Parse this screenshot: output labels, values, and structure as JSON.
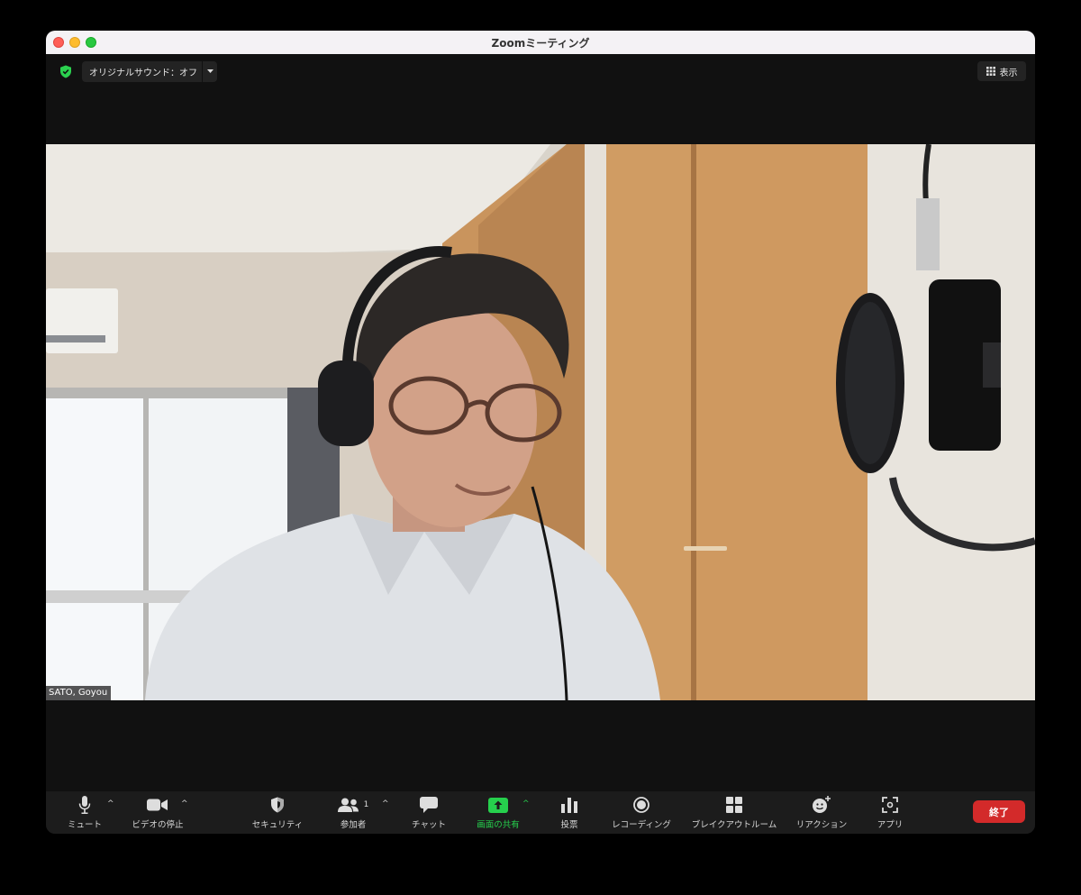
{
  "window": {
    "title": "Zoomミーティング"
  },
  "topbar": {
    "original_sound": "オリジナルサウンド：オフ",
    "view_label": "表示",
    "shield_color": "#2bd14f"
  },
  "video": {
    "participant_name": "SATO, Goyou"
  },
  "toolbar": {
    "mute": "ミュート",
    "stop_video": "ビデオの停止",
    "security": "セキュリティ",
    "participants": "参加者",
    "participants_count": "1",
    "chat": "チャット",
    "share_screen": "画面の共有",
    "polls": "投票",
    "recording": "レコーディング",
    "breakout": "ブレイクアウトルーム",
    "reactions": "リアクション",
    "apps": "アプリ",
    "end": "終了",
    "accent_green": "#26d04d",
    "end_color": "#d32a2a"
  }
}
